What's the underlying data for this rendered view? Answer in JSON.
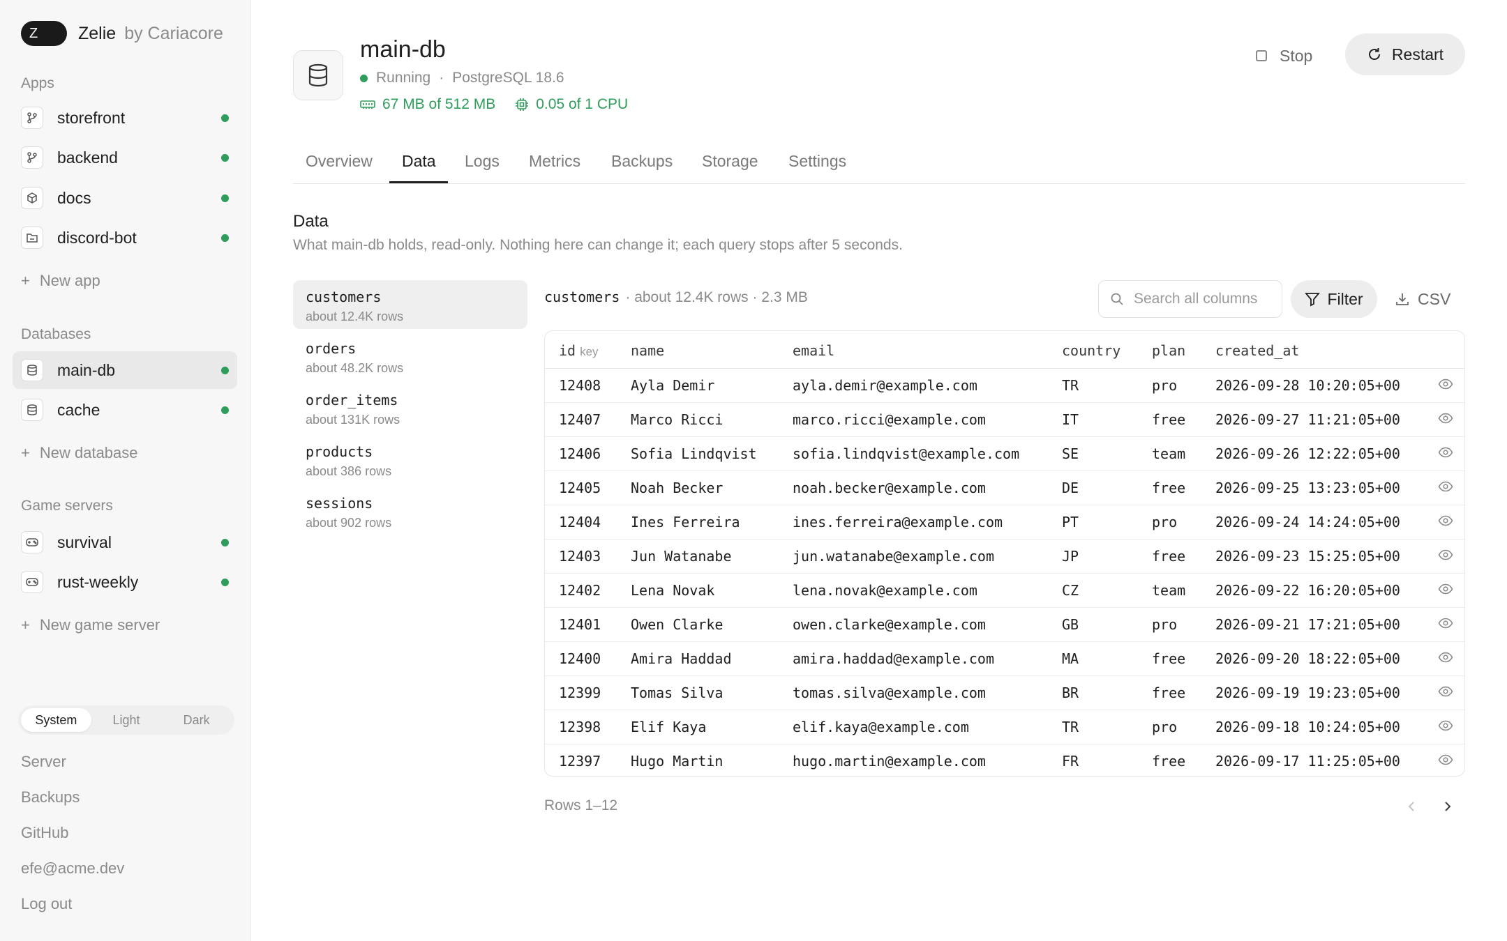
{
  "brand": {
    "initial": "Z",
    "name": "Zelie",
    "by": "by Cariacore"
  },
  "sidebar": {
    "apps_label": "Apps",
    "apps": [
      {
        "label": "storefront",
        "icon": "branch-icon",
        "status": "running"
      },
      {
        "label": "backend",
        "icon": "branch-icon",
        "status": "running"
      },
      {
        "label": "docs",
        "icon": "cube-icon",
        "status": "running"
      },
      {
        "label": "discord-bot",
        "icon": "folder-icon",
        "status": "running"
      }
    ],
    "new_app": "New app",
    "databases_label": "Databases",
    "databases": [
      {
        "label": "main-db",
        "icon": "database-icon",
        "status": "running",
        "active": true
      },
      {
        "label": "cache",
        "icon": "database-icon",
        "status": "running"
      }
    ],
    "new_database": "New database",
    "game_servers_label": "Game servers",
    "game_servers": [
      {
        "label": "survival",
        "icon": "gamepad-icon",
        "status": "running"
      },
      {
        "label": "rust-weekly",
        "icon": "gamepad-icon",
        "status": "running"
      }
    ],
    "new_game_server": "New game server",
    "theme": {
      "options": [
        "System",
        "Light",
        "Dark"
      ],
      "selected": "System"
    },
    "footer_links": [
      "Server",
      "Backups",
      "GitHub",
      "efe@acme.dev",
      "Log out"
    ]
  },
  "header": {
    "title": "main-db",
    "status": "Running",
    "engine": "PostgreSQL 18.6",
    "memory": "67 MB of 512 MB",
    "cpu": "0.05 of 1 CPU",
    "stop_label": "Stop",
    "restart_label": "Restart"
  },
  "tabs": [
    "Overview",
    "Data",
    "Logs",
    "Metrics",
    "Backups",
    "Storage",
    "Settings"
  ],
  "active_tab": "Data",
  "data_section": {
    "title": "Data",
    "subtitle": "What main-db holds, read-only. Nothing here can change it; each query stops after 5 seconds."
  },
  "tables_list": [
    {
      "name": "customers",
      "rows": "about 12.4K rows",
      "active": true
    },
    {
      "name": "orders",
      "rows": "about 48.2K rows"
    },
    {
      "name": "order_items",
      "rows": "about 131K rows"
    },
    {
      "name": "products",
      "rows": "about 386 rows"
    },
    {
      "name": "sessions",
      "rows": "about 902 rows"
    }
  ],
  "table_view": {
    "name": "customers",
    "meta": "· about 12.4K rows · 2.3 MB",
    "search_placeholder": "Search all columns",
    "filter_label": "Filter",
    "csv_label": "CSV",
    "columns": [
      "id",
      "name",
      "email",
      "country",
      "plan",
      "created_at"
    ],
    "key_label": "key",
    "rows": [
      [
        "12408",
        "Ayla Demir",
        "ayla.demir@example.com",
        "TR",
        "pro",
        "2026-09-28 10:20:05+00"
      ],
      [
        "12407",
        "Marco Ricci",
        "marco.ricci@example.com",
        "IT",
        "free",
        "2026-09-27 11:21:05+00"
      ],
      [
        "12406",
        "Sofia Lindqvist",
        "sofia.lindqvist@example.com",
        "SE",
        "team",
        "2026-09-26 12:22:05+00"
      ],
      [
        "12405",
        "Noah Becker",
        "noah.becker@example.com",
        "DE",
        "free",
        "2026-09-25 13:23:05+00"
      ],
      [
        "12404",
        "Ines Ferreira",
        "ines.ferreira@example.com",
        "PT",
        "pro",
        "2026-09-24 14:24:05+00"
      ],
      [
        "12403",
        "Jun Watanabe",
        "jun.watanabe@example.com",
        "JP",
        "free",
        "2026-09-23 15:25:05+00"
      ],
      [
        "12402",
        "Lena Novak",
        "lena.novak@example.com",
        "CZ",
        "team",
        "2026-09-22 16:20:05+00"
      ],
      [
        "12401",
        "Owen Clarke",
        "owen.clarke@example.com",
        "GB",
        "pro",
        "2026-09-21 17:21:05+00"
      ],
      [
        "12400",
        "Amira Haddad",
        "amira.haddad@example.com",
        "MA",
        "free",
        "2026-09-20 18:22:05+00"
      ],
      [
        "12399",
        "Tomas Silva",
        "tomas.silva@example.com",
        "BR",
        "free",
        "2026-09-19 19:23:05+00"
      ],
      [
        "12398",
        "Elif Kaya",
        "elif.kaya@example.com",
        "TR",
        "pro",
        "2026-09-18 10:24:05+00"
      ],
      [
        "12397",
        "Hugo Martin",
        "hugo.martin@example.com",
        "FR",
        "free",
        "2026-09-17 11:25:05+00"
      ]
    ],
    "rows_info": "Rows 1–12"
  },
  "colors": {
    "accent_green": "#2e9d5b",
    "text": "#1f1f1f",
    "muted": "#8a8a8a"
  }
}
